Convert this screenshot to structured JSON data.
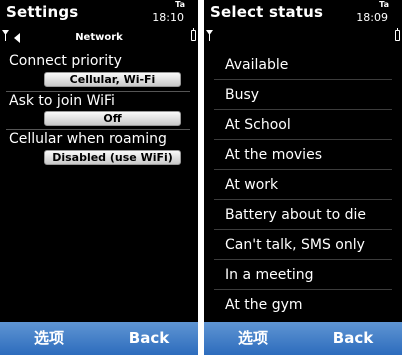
{
  "left_screen": {
    "title": "Settings",
    "clock": "18:10",
    "network_badge": "Ta",
    "subheader": "Network",
    "settings": [
      {
        "label": "Connect priority",
        "value": "Cellular, Wi-Fi"
      },
      {
        "label": "Ask to join WiFi",
        "value": "Off"
      },
      {
        "label": "Cellular when roaming",
        "value": "Disabled (use WiFi)"
      }
    ],
    "softkeys": {
      "left": "选项",
      "right": "Back"
    }
  },
  "right_screen": {
    "title": "Select status",
    "clock": "18:09",
    "network_badge": "Ta",
    "statuses": [
      "Available",
      "Busy",
      "At School",
      "At the movies",
      "At work",
      "Battery about to die",
      "Can't talk, SMS only",
      "In a meeting",
      "At the gym"
    ],
    "softkeys": {
      "left": "选项",
      "right": "Back"
    }
  }
}
